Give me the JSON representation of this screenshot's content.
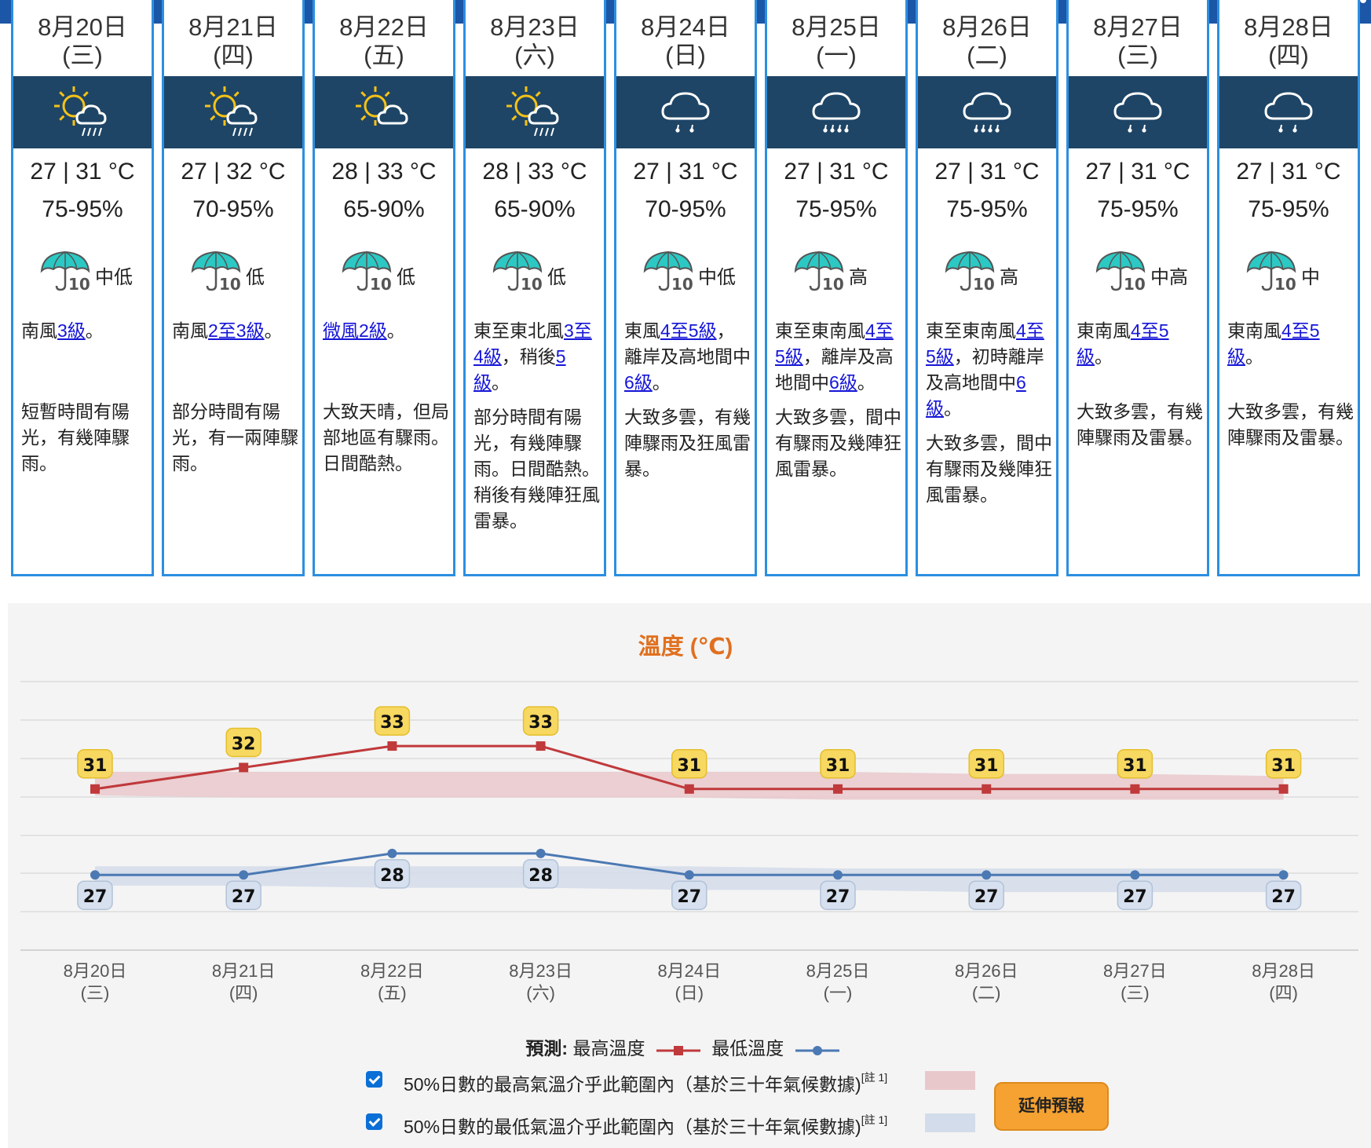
{
  "days": [
    {
      "date": "8月20日",
      "weekday": "(三)",
      "icon": "sunny-periods-showers-icon",
      "min": "27",
      "max": "31",
      "temp": "27 | 31 °C",
      "humidity": "75-95%",
      "rain_level": "中低",
      "wind": [
        {
          "t": "南風"
        },
        {
          "t": "3級",
          "link": true
        },
        {
          "t": "。"
        }
      ],
      "desc": "短暫時間有陽光，有幾陣驟雨。"
    },
    {
      "date": "8月21日",
      "weekday": "(四)",
      "icon": "sunny-periods-showers-icon",
      "min": "27",
      "max": "32",
      "temp": "27 | 32 °C",
      "humidity": "70-95%",
      "rain_level": "低",
      "wind": [
        {
          "t": "南風"
        },
        {
          "t": "2至3級",
          "link": true
        },
        {
          "t": "。"
        }
      ],
      "desc": "部分時間有陽光，有一兩陣驟雨。"
    },
    {
      "date": "8月22日",
      "weekday": "(五)",
      "icon": "sunny-periods-icon",
      "min": "28",
      "max": "33",
      "temp": "28 | 33 °C",
      "humidity": "65-90%",
      "rain_level": "低",
      "wind": [
        {
          "t": "微風2級",
          "link": true
        },
        {
          "t": "。"
        }
      ],
      "desc": "大致天晴，但局部地區有驟雨。日間酷熱。"
    },
    {
      "date": "8月23日",
      "weekday": "(六)",
      "icon": "sunny-periods-showers-icon",
      "min": "28",
      "max": "33",
      "temp": "28 | 33 °C",
      "humidity": "65-90%",
      "rain_level": "低",
      "wind": [
        {
          "t": "東至東北風"
        },
        {
          "t": "3至4級",
          "link": true
        },
        {
          "t": "，稍後"
        },
        {
          "t": "5級",
          "link": true
        },
        {
          "t": "。"
        }
      ],
      "desc": "部分時間有陽光，有幾陣驟雨。日間酷熱。稍後有幾陣狂風雷暴。"
    },
    {
      "date": "8月24日",
      "weekday": "(日)",
      "icon": "showers-icon",
      "min": "27",
      "max": "31",
      "temp": "27 | 31 °C",
      "humidity": "70-95%",
      "rain_level": "中低",
      "wind": [
        {
          "t": "東風"
        },
        {
          "t": "4至5級",
          "link": true
        },
        {
          "t": "，離岸及高地間中"
        },
        {
          "t": "6級",
          "link": true
        },
        {
          "t": "。"
        }
      ],
      "desc": "大致多雲，有幾陣驟雨及狂風雷暴。"
    },
    {
      "date": "8月25日",
      "weekday": "(一)",
      "icon": "heavy-showers-icon",
      "min": "27",
      "max": "31",
      "temp": "27 | 31 °C",
      "humidity": "75-95%",
      "rain_level": "高",
      "wind": [
        {
          "t": "東至東南風"
        },
        {
          "t": "4至5級",
          "link": true
        },
        {
          "t": "，離岸及高地間中"
        },
        {
          "t": "6級",
          "link": true
        },
        {
          "t": "。"
        }
      ],
      "desc": "大致多雲，間中有驟雨及幾陣狂風雷暴。"
    },
    {
      "date": "8月26日",
      "weekday": "(二)",
      "icon": "heavy-showers-icon",
      "min": "27",
      "max": "31",
      "temp": "27 | 31 °C",
      "humidity": "75-95%",
      "rain_level": "高",
      "wind": [
        {
          "t": "東至東南風"
        },
        {
          "t": "4至5級",
          "link": true
        },
        {
          "t": "，初時離岸及高地間中"
        },
        {
          "t": "6級",
          "link": true
        },
        {
          "t": "。"
        }
      ],
      "desc": "大致多雲，間中有驟雨及幾陣狂風雷暴。"
    },
    {
      "date": "8月27日",
      "weekday": "(三)",
      "icon": "showers-icon",
      "min": "27",
      "max": "31",
      "temp": "27 | 31 °C",
      "humidity": "75-95%",
      "rain_level": "中高",
      "wind": [
        {
          "t": "東南風"
        },
        {
          "t": "4至5級",
          "link": true
        },
        {
          "t": "。"
        }
      ],
      "desc": "大致多雲，有幾陣驟雨及雷暴。"
    },
    {
      "date": "8月28日",
      "weekday": "(四)",
      "icon": "showers-icon",
      "min": "27",
      "max": "31",
      "temp": "27 | 31 °C",
      "humidity": "75-95%",
      "rain_level": "中",
      "wind": [
        {
          "t": "東南風"
        },
        {
          "t": "4至5級",
          "link": true
        },
        {
          "t": "。"
        }
      ],
      "desc": "大致多雲，有幾陣驟雨及雷暴。"
    }
  ],
  "rain_icon_label": "10",
  "chart_data": {
    "type": "line",
    "title": "溫度 (℃)",
    "categories": [
      "8月20日",
      "8月21日",
      "8月22日",
      "8月23日",
      "8月24日",
      "8月25日",
      "8月26日",
      "8月27日",
      "8月28日"
    ],
    "category_sublabels": [
      "(三)",
      "(四)",
      "(五)",
      "(六)",
      "(日)",
      "(一)",
      "(二)",
      "(三)",
      "(四)"
    ],
    "series": [
      {
        "name": "最高溫度",
        "values": [
          31,
          32,
          33,
          33,
          31,
          31,
          31,
          31,
          31
        ],
        "color": "#c0393b"
      },
      {
        "name": "最低溫度",
        "values": [
          27,
          27,
          28,
          28,
          27,
          27,
          27,
          27,
          27
        ],
        "color": "#4b79b3"
      }
    ],
    "bands": [
      {
        "name": "50%日數的最高氣溫介乎此範圍內",
        "upper": [
          31.8,
          31.8,
          31.8,
          31.8,
          31.8,
          31.8,
          31.7,
          31.7,
          31.6
        ],
        "lower": [
          30.7,
          30.6,
          30.6,
          30.6,
          30.6,
          30.5,
          30.5,
          30.5,
          30.5
        ],
        "color": "#e9c8cb"
      },
      {
        "name": "50%日數的最低氣溫介乎此範圍內",
        "upper": [
          27.4,
          27.4,
          27.4,
          27.4,
          27.4,
          27.3,
          27.3,
          27.3,
          27.3
        ],
        "lower": [
          26.5,
          26.5,
          26.4,
          26.4,
          26.3,
          26.3,
          26.2,
          26.2,
          26.2
        ],
        "color": "#d3dcea"
      }
    ],
    "ylim": [
      23.5,
      36
    ],
    "grid": true,
    "legend": "bottom-center"
  },
  "legend": {
    "prefix": "預測:",
    "max_label": "最高溫度",
    "min_label": "最低溫度",
    "band_max_text": "50%日數的最高氣溫介乎此範圍內（基於三十年氣候數據)",
    "band_min_text": "50%日數的最低氣溫介乎此範圍內（基於三十年氣候數據)",
    "note": "[註 1]"
  },
  "extend_button": "延伸預報"
}
